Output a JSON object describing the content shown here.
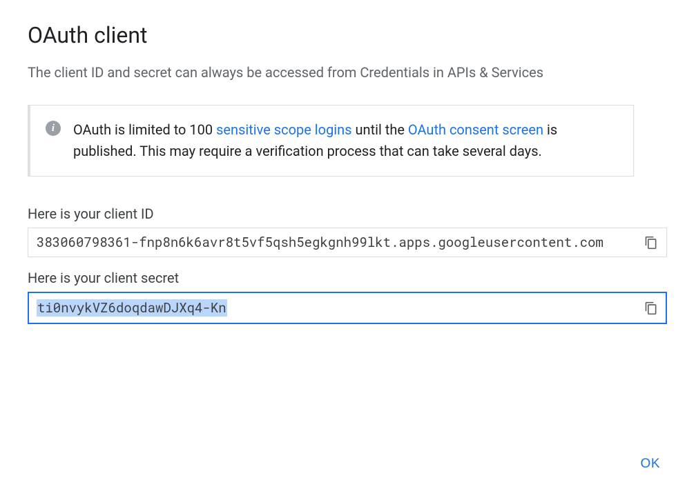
{
  "title": "OAuth client",
  "subtitle": "The client ID and secret can always be accessed from Credentials in APIs & Services",
  "info": {
    "prefix": "OAuth is limited to 100 ",
    "link1": "sensitive scope logins",
    "middle": " until the ",
    "link2": "OAuth consent screen",
    "suffix": " is published. This may require a verification process that can take several days."
  },
  "client_id": {
    "label": "Here is your client ID",
    "value": "383060798361-fnp8n6k6avr8t5vf5qsh5egkgnh99lkt.apps.googleusercontent.com"
  },
  "client_secret": {
    "label": "Here is your client secret",
    "value": "ti0nvykVZ6doqdawDJXq4-Kn"
  },
  "ok_label": "OK"
}
